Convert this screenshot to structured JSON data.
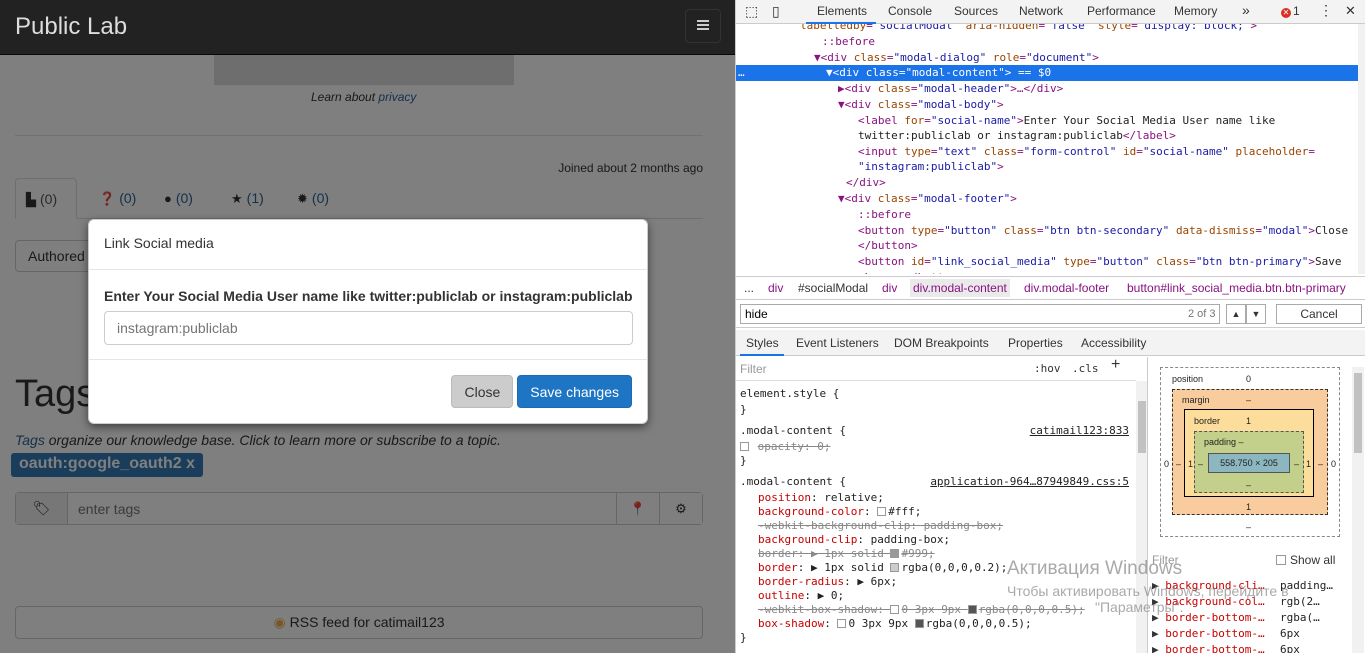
{
  "site": {
    "brand": "Public Lab",
    "learn_prefix": "Learn about ",
    "learn_link": "privacy",
    "joined": "Joined about 2 months ago",
    "tabs": [
      {
        "icon": "file-icon",
        "glyph": "▙",
        "count": "(0)"
      },
      {
        "icon": "question-icon",
        "glyph": "❓",
        "count": "(0)"
      },
      {
        "icon": "comment-icon",
        "glyph": "●",
        "count": "(0)"
      },
      {
        "icon": "star-icon",
        "glyph": "★",
        "count": "(1)"
      },
      {
        "icon": "gear-icon",
        "glyph": "✹",
        "count": "(0)"
      }
    ],
    "authored": "Authored",
    "tags_heading": "Tags",
    "tags_desc_link": "Tags",
    "tags_desc_rest": " organize our knowledge base. Click to learn more or subscribe to a topic.",
    "tag_badge": "oauth:google_oauth2 x",
    "tag_placeholder": "enter tags",
    "rss_label": "RSS feed for catimail123"
  },
  "modal": {
    "title": "Link Social media",
    "label": "Enter Your Social Media User name like twitter:publiclab or instagram:publiclab",
    "placeholder": "instagram:publiclab",
    "close_label": "Close",
    "save_label": "Save changes"
  },
  "devtools": {
    "tabs": [
      "Elements",
      "Console",
      "Sources",
      "Network",
      "Performance",
      "Memory"
    ],
    "more": "»",
    "error_count": "1",
    "crumbs": [
      "...",
      "div",
      "#socialModal",
      "div",
      "div.modal-content",
      "div.modal-footer",
      "button#link_social_media.btn.btn-primary"
    ],
    "search_value": "hide",
    "search_count": "2 of 3",
    "search_cancel": "Cancel",
    "subtabs": [
      "Styles",
      "Event Listeners",
      "DOM Breakpoints",
      "Properties",
      "Accessibility"
    ],
    "filter_placeholder": "Filter",
    "hov": ":hov",
    "cls": ".cls",
    "plus": "+",
    "boxmodel": {
      "position_label": "position",
      "position_value": "0",
      "margin_label": "margin",
      "margin_value": "–",
      "border_label": "border",
      "border_value": "1",
      "padding_label": "padding –",
      "padding_bottom": "–",
      "content": "558.750 × 205",
      "side_zero": "0",
      "side_dash": "–",
      "side_one": "1",
      "filter": "Filter",
      "show_all": "Show all"
    },
    "computed": [
      {
        "name": "background-cli…",
        "value": "padding…"
      },
      {
        "name": "background-col…",
        "value": "rgb(2…"
      },
      {
        "name": "border-bottom-…",
        "value": "rgba(…"
      },
      {
        "name": "border-bottom-…",
        "value": "6px"
      },
      {
        "name": "border-bottom-…",
        "value": "6px"
      }
    ]
  },
  "watermark": {
    "line1": "Активация Windows",
    "line2": "Чтобы активировать Windows, перейдите в",
    "line3": "\"Параметры\"."
  }
}
